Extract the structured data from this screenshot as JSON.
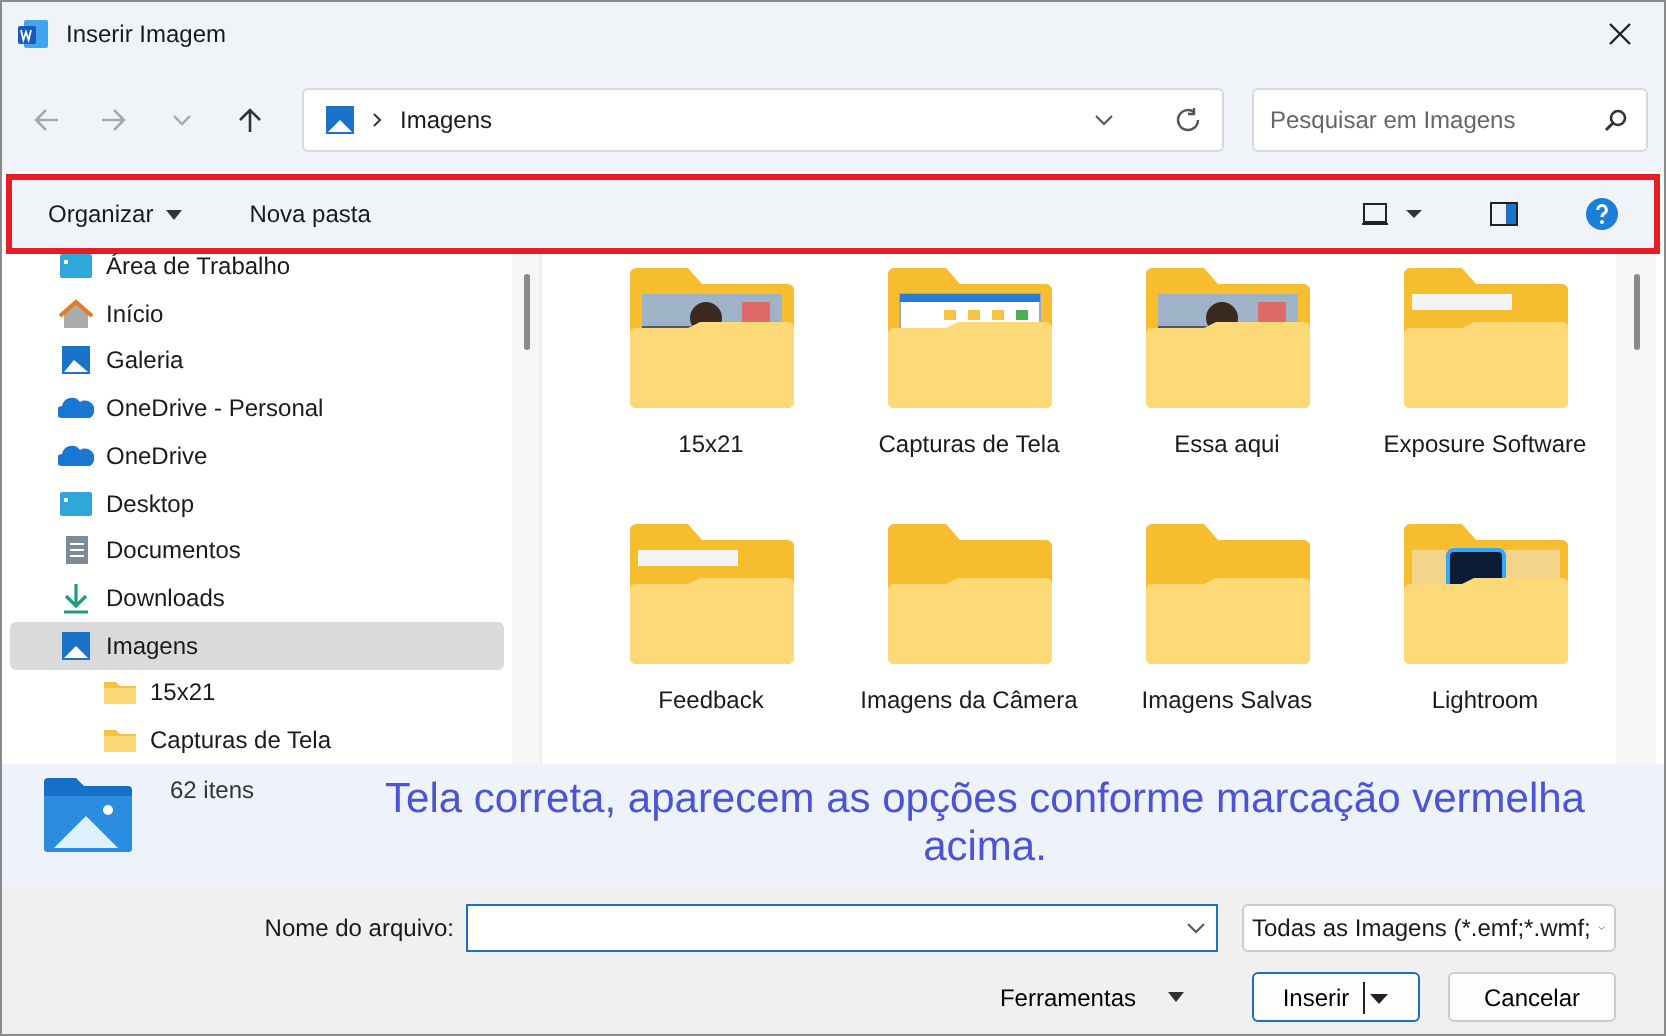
{
  "window": {
    "title": "Inserir Imagem"
  },
  "nav_buttons": [
    {
      "kind": "back",
      "disabled": true
    },
    {
      "kind": "forward",
      "disabled": true
    },
    {
      "kind": "recent",
      "disabled": true
    },
    {
      "kind": "up",
      "disabled": false
    }
  ],
  "address": {
    "path": "Imagens"
  },
  "search": {
    "placeholder": "Pesquisar em Imagens"
  },
  "toolbar": {
    "organize": "Organizar",
    "new_folder": "Nova pasta",
    "highlighted": true
  },
  "sidebar": {
    "items": [
      {
        "label": "Área de Trabalho",
        "kind": "desktop",
        "selected": false
      },
      {
        "label": "Início",
        "kind": "home",
        "selected": false
      },
      {
        "label": "Galeria",
        "kind": "gallery",
        "selected": false
      },
      {
        "label": "OneDrive - Personal",
        "kind": "cloud",
        "selected": false
      },
      {
        "label": "OneDrive",
        "kind": "cloud",
        "selected": false
      },
      {
        "label": "Desktop",
        "kind": "desktop",
        "selected": false
      },
      {
        "label": "Documentos",
        "kind": "document",
        "selected": false
      },
      {
        "label": "Downloads",
        "kind": "download",
        "selected": false
      },
      {
        "label": "Imagens",
        "kind": "pictures",
        "selected": true,
        "children": [
          {
            "label": "15x21",
            "kind": "folder",
            "selected": false
          },
          {
            "label": "Capturas de Tela",
            "kind": "folder",
            "selected": false
          }
        ]
      }
    ]
  },
  "folders": [
    {
      "name": "15x21",
      "kind": "photo"
    },
    {
      "name": "Capturas de Tela",
      "kind": "screenshot"
    },
    {
      "name": "Essa aqui",
      "kind": "photo"
    },
    {
      "name": "Exposure Software",
      "kind": "paper"
    },
    {
      "name": "Feedback",
      "kind": "paper"
    },
    {
      "name": "Imagens da Câmera",
      "kind": "plain"
    },
    {
      "name": "Imagens Salvas",
      "kind": "plain"
    },
    {
      "name": "Lightroom",
      "kind": "app"
    }
  ],
  "status": {
    "count": "62 itens"
  },
  "annotation": {
    "text": "Tela correta, aparecem as opções conforme marcação vermelha acima."
  },
  "file_name": {
    "label": "Nome do arquivo:"
  },
  "file_type": {
    "value": "Todas as Imagens (*.emf;*.wmf;"
  },
  "buttons": {
    "tools": "Ferramentas",
    "insert": "Inserir",
    "cancel": "Cancelar"
  }
}
